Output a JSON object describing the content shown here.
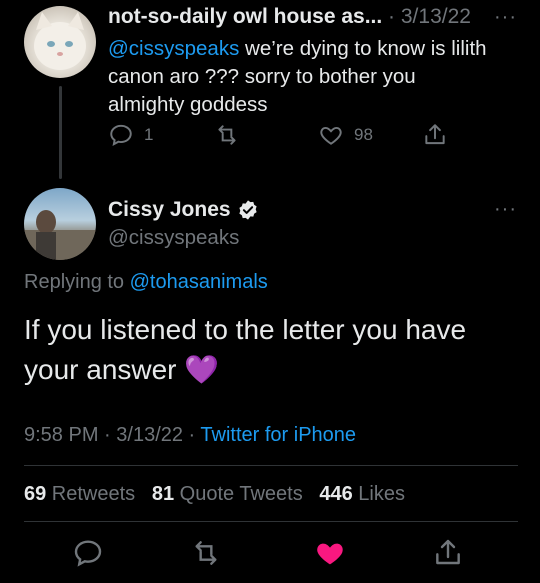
{
  "parent_tweet": {
    "display_name": "not-so-daily owl house as...",
    "separator": " · ",
    "date": "3/13/22",
    "more_icon": "more-horizontal-icon",
    "mention": "@cissyspeaks",
    "text_line1": " we’re dying to know is lilith",
    "text_line2": "canon aro ??? sorry to bother you",
    "text_line3": "almighty goddess",
    "reply_count": "1",
    "retweet_count": "",
    "like_count": "98"
  },
  "main_tweet": {
    "display_name": "Cissy Jones",
    "verified_icon": "verified-badge-icon",
    "handle": "@cissyspeaks",
    "replying_prefix": "Replying to ",
    "replying_to": "@tohasanimals",
    "text_line1": "If you listened to the letter you have",
    "text_line2": "your answer",
    "emoji": "💜",
    "time": "9:58 PM",
    "dot": " · ",
    "date": "3/13/22",
    "source": "Twitter for iPhone",
    "retweets_count": "69",
    "retweets_label": " Retweets",
    "quotes_count": "81",
    "quotes_label": " Quote Tweets",
    "likes_count": "446",
    "likes_label": " Likes",
    "liked": true,
    "like_color": "#f91880"
  }
}
